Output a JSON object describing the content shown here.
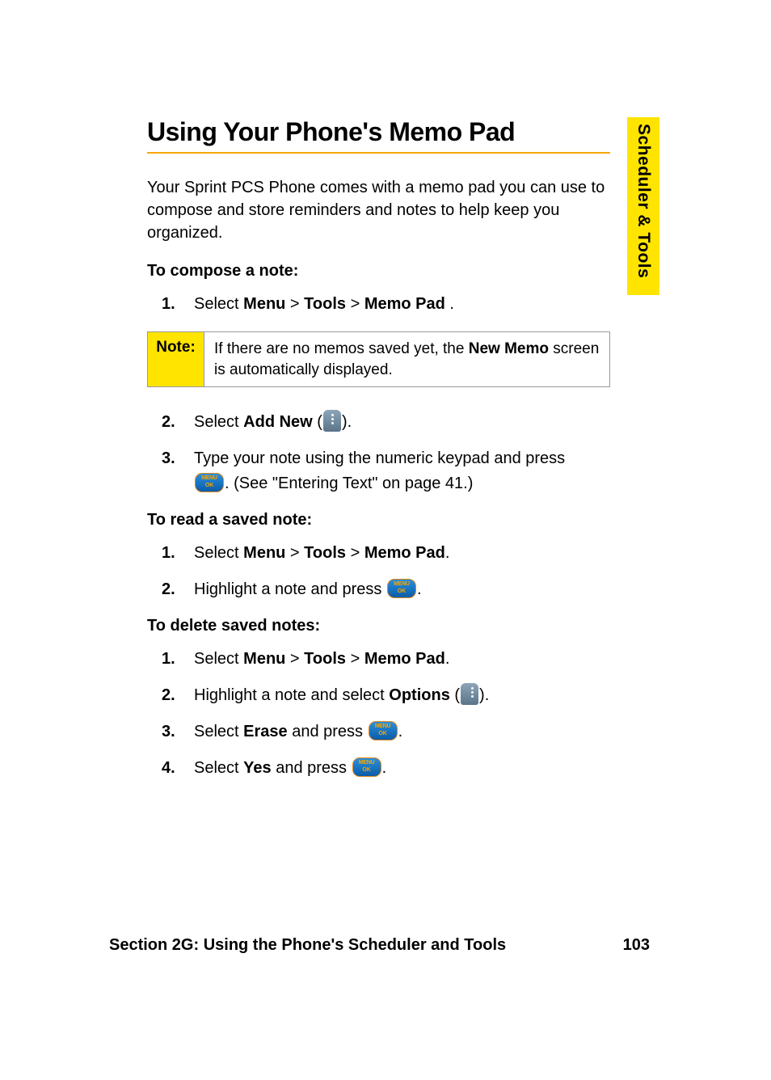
{
  "sidebar": {
    "label": "Scheduler & Tools"
  },
  "heading": "Using Your Phone's Memo Pad",
  "intro": "Your Sprint PCS Phone comes with a memo pad you can use to compose and store reminders and notes to help keep you organized.",
  "sections": {
    "compose": {
      "title": "To compose a note:",
      "step1_pre": "Select ",
      "step1_menu": "Menu",
      "step1_tools": "Tools",
      "step1_memopad": "Memo Pad ",
      "step1_post": ".",
      "note_label": "Note:",
      "note_pre": "If there are no memos saved yet, the ",
      "note_bold": "New Memo",
      "note_post": " screen is automatically displayed.",
      "step2_pre": "Select ",
      "step2_bold": "Add New",
      "step2_paren_open": " (",
      "step2_paren_close": ").",
      "step3_line1": "Type your note using the numeric keypad and press ",
      "step3_line2": ". (See \"Entering Text\" on page 41.)"
    },
    "read": {
      "title": "To read a saved note:",
      "step1_pre": "Select ",
      "step1_menu": "Menu",
      "step1_tools": "Tools",
      "step1_memopad": "Memo Pad",
      "step1_post": ".",
      "step2_pre": "Highlight a note and press ",
      "step2_post": "."
    },
    "delete": {
      "title": "To delete saved notes:",
      "step1_pre": "Select ",
      "step1_menu": "Menu",
      "step1_tools": "Tools",
      "step1_memopad": "Memo Pad",
      "step1_post": ".",
      "step2_pre": "Highlight a note and select ",
      "step2_bold": "Options",
      "step2_paren_open": " (",
      "step2_paren_close": ").",
      "step3_pre": "Select ",
      "step3_bold": "Erase",
      "step3_mid": " and press ",
      "step3_post": ".",
      "step4_pre": "Select ",
      "step4_bold": "Yes",
      "step4_mid": " and press ",
      "step4_post": "."
    }
  },
  "nums": {
    "n1": "1.",
    "n2": "2.",
    "n3": "3.",
    "n4": "4."
  },
  "sep": " > ",
  "footer": {
    "section": "Section 2G: Using the Phone's Scheduler and Tools",
    "page": "103"
  }
}
